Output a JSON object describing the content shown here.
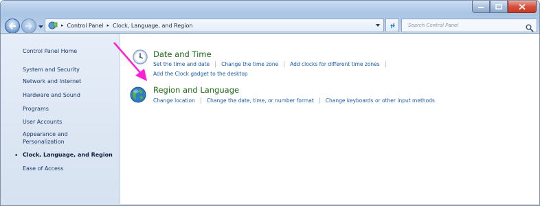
{
  "address": {
    "crumbs": [
      "Control Panel",
      "Clock, Language, and Region"
    ]
  },
  "search": {
    "placeholder": "Search Control Panel"
  },
  "sidebar": {
    "home": "Control Panel Home",
    "items": [
      {
        "label": "System and Security"
      },
      {
        "label": "Network and Internet"
      },
      {
        "label": "Hardware and Sound"
      },
      {
        "label": "Programs"
      },
      {
        "label": "User Accounts"
      },
      {
        "label": "Appearance and Personalization"
      },
      {
        "label": "Clock, Language, and Region",
        "active": true
      },
      {
        "label": "Ease of Access"
      }
    ]
  },
  "main": {
    "categories": [
      {
        "title": "Date and Time",
        "icon": "clock-icon",
        "tasks": [
          "Set the time and date",
          "Change the time zone",
          "Add clocks for different time zones",
          "Add the Clock gadget to the desktop"
        ]
      },
      {
        "title": "Region and Language",
        "icon": "globe-icon",
        "tasks": [
          "Change location",
          "Change the date, time, or number format",
          "Change keyboards or other input methods"
        ]
      }
    ]
  },
  "annotation": {
    "arrow_color": "#ff1fd6"
  },
  "colors": {
    "category_title": "#1e6b14",
    "task_link": "#1a5aa8",
    "sidebar_link": "#1c3a6b"
  }
}
